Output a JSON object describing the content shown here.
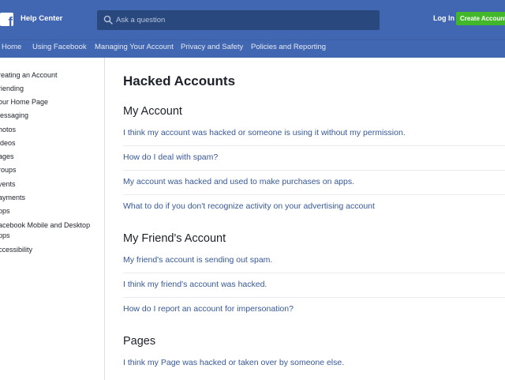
{
  "header": {
    "brand": "Help Center",
    "search_placeholder": "Ask a question",
    "login_label": "Log In",
    "create_account_label": "Create Account",
    "nav": [
      "Home",
      "Using Facebook",
      "Managing Your Account",
      "Privacy and Safety",
      "Policies and Reporting"
    ]
  },
  "sidebar": {
    "items": [
      "reating an Account",
      "riending",
      "our Home Page",
      "lessaging",
      "hotos",
      "ideos",
      "ages",
      "roups",
      "vents",
      "ayments",
      "pps",
      "acebook Mobile and Desktop pps",
      "ccessibility"
    ]
  },
  "main": {
    "title": "Hacked Accounts",
    "sections": [
      {
        "title": "My Account",
        "articles": [
          "I think my account was hacked or someone is using it without my permission.",
          "How do I deal with spam?",
          "My account was hacked and used to make purchases on apps.",
          "What to do if you don't recognize activity on your advertising account"
        ]
      },
      {
        "title": "My Friend's Account",
        "articles": [
          "My friend's account is sending out spam.",
          "I think my friend's account was hacked.",
          "How do I report an account for impersonation?"
        ]
      },
      {
        "title": "Pages",
        "articles": [
          "I think my Page was hacked or taken over by someone else."
        ]
      }
    ]
  },
  "icons": {
    "logo": "facebook-logo-icon",
    "search": "search-icon"
  },
  "colors": {
    "brand_blue": "#4267b2",
    "search_bg": "#29487d",
    "create_green": "#42b72a",
    "link": "#365899"
  }
}
